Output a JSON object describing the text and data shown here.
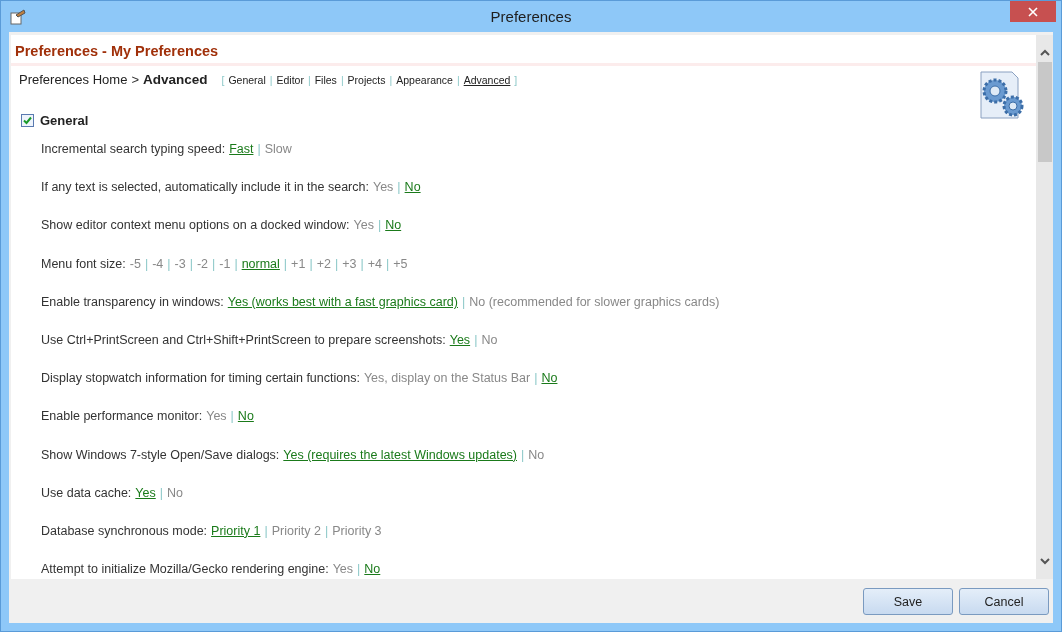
{
  "window": {
    "title": "Preferences"
  },
  "page_title": "Preferences - My Preferences",
  "breadcrumb": {
    "home": "Preferences Home",
    "separator": ">",
    "current": "Advanced"
  },
  "nav": {
    "open": "[",
    "close": "]",
    "separator": "|",
    "links": [
      {
        "label": "General",
        "selected": false
      },
      {
        "label": "Editor",
        "selected": false
      },
      {
        "label": "Files",
        "selected": false
      },
      {
        "label": "Projects",
        "selected": false
      },
      {
        "label": "Appearance",
        "selected": false
      },
      {
        "label": "Advanced",
        "selected": true
      }
    ]
  },
  "section": {
    "title": "General",
    "checked": true
  },
  "option_separator": "|",
  "settings": [
    {
      "label": "Incremental search typing speed:",
      "options": [
        {
          "label": "Fast",
          "selected": true
        },
        {
          "label": "Slow",
          "selected": false
        }
      ]
    },
    {
      "label": "If any text is selected, automatically include it in the search:",
      "options": [
        {
          "label": "Yes",
          "selected": false
        },
        {
          "label": "No",
          "selected": true
        }
      ]
    },
    {
      "label": "Show editor context menu options on a docked window:",
      "options": [
        {
          "label": "Yes",
          "selected": false
        },
        {
          "label": "No",
          "selected": true
        }
      ]
    },
    {
      "label": "Menu font size:",
      "options": [
        {
          "label": "-5",
          "selected": false
        },
        {
          "label": "-4",
          "selected": false
        },
        {
          "label": "-3",
          "selected": false
        },
        {
          "label": "-2",
          "selected": false
        },
        {
          "label": "-1",
          "selected": false
        },
        {
          "label": "normal",
          "selected": true
        },
        {
          "label": "+1",
          "selected": false
        },
        {
          "label": "+2",
          "selected": false
        },
        {
          "label": "+3",
          "selected": false
        },
        {
          "label": "+4",
          "selected": false
        },
        {
          "label": "+5",
          "selected": false
        }
      ]
    },
    {
      "label": "Enable transparency in windows:",
      "options": [
        {
          "label": "Yes (works best with a fast graphics card)",
          "selected": true
        },
        {
          "label": "No (recommended for slower graphics cards)",
          "selected": false
        }
      ]
    },
    {
      "label": "Use Ctrl+PrintScreen and Ctrl+Shift+PrintScreen to prepare screenshots:",
      "options": [
        {
          "label": "Yes",
          "selected": true
        },
        {
          "label": "No",
          "selected": false
        }
      ]
    },
    {
      "label": "Display stopwatch information for timing certain functions:",
      "options": [
        {
          "label": "Yes, display on the Status Bar",
          "selected": false
        },
        {
          "label": "No",
          "selected": true
        }
      ]
    },
    {
      "label": "Enable performance monitor:",
      "options": [
        {
          "label": "Yes",
          "selected": false
        },
        {
          "label": "No",
          "selected": true
        }
      ]
    },
    {
      "label": "Show Windows 7-style Open/Save dialogs:",
      "options": [
        {
          "label": "Yes (requires the latest Windows updates)",
          "selected": true
        },
        {
          "label": "No",
          "selected": false
        }
      ]
    },
    {
      "label": "Use data cache:",
      "options": [
        {
          "label": "Yes",
          "selected": true
        },
        {
          "label": "No",
          "selected": false
        }
      ]
    },
    {
      "label": "Database synchronous mode:",
      "options": [
        {
          "label": "Priority 1",
          "selected": true
        },
        {
          "label": "Priority 2",
          "selected": false
        },
        {
          "label": "Priority 3",
          "selected": false
        }
      ]
    },
    {
      "label": "Attempt to initialize Mozilla/Gecko rendering engine:",
      "options": [
        {
          "label": "Yes",
          "selected": false
        },
        {
          "label": "No",
          "selected": true
        }
      ]
    }
  ],
  "buttons": [
    {
      "label": "Save"
    },
    {
      "label": "Cancel"
    }
  ]
}
